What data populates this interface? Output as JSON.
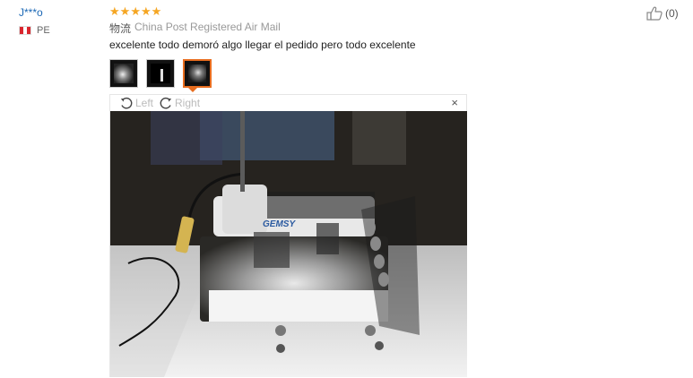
{
  "review": {
    "user": "J***o",
    "country_code": "PE",
    "rating": 5,
    "logistics_label": "物流",
    "logistics_value": "China Post Registered Air Mail",
    "text": "excelente todo demoró algo llegar el pedido pero todo excelente",
    "helpful_count": "(0)"
  },
  "viewer": {
    "rotate_left": "Left",
    "rotate_right": "Right",
    "close": "×",
    "thumbnails": 3,
    "active_thumbnail": 3,
    "photo_brand_text": "GEMSY"
  },
  "colors": {
    "user_link": "#1a67b5",
    "star": "#f5a623",
    "active_thumb_border": "#e86d1f"
  },
  "icons": {
    "helpful": "thumbs-up-icon",
    "rotate_left": "rotate-left-icon",
    "rotate_right": "rotate-right-icon",
    "close": "close-icon",
    "flag": "peru-flag-icon",
    "star": "star-icon"
  }
}
